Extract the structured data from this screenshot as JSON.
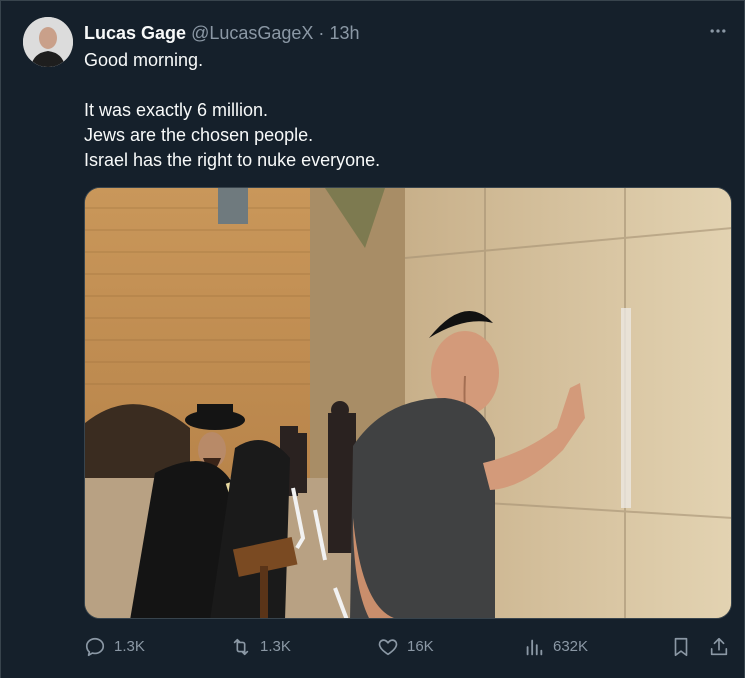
{
  "author": {
    "name": "Lucas Gage",
    "handle": "@LucasGageX",
    "separator": "·",
    "time": "13h"
  },
  "tweet": {
    "lines": [
      "Good morning.",
      "",
      "It was exactly 6 million.",
      "Jews are the chosen people.",
      "Israel has the right to nuke everyone."
    ]
  },
  "actions": {
    "replies": "1.3K",
    "retweets": "1.3K",
    "likes": "16K",
    "views": "632K"
  },
  "icons": {
    "more": "more-horizontal-icon",
    "reply": "reply-icon",
    "retweet": "retweet-icon",
    "like": "heart-icon",
    "views": "views-icon",
    "bookmark": "bookmark-icon",
    "share": "share-icon"
  },
  "colors": {
    "background": "#15202b",
    "text": "#f7f9f9",
    "secondary": "#8b98a5",
    "border": "#38444d"
  }
}
